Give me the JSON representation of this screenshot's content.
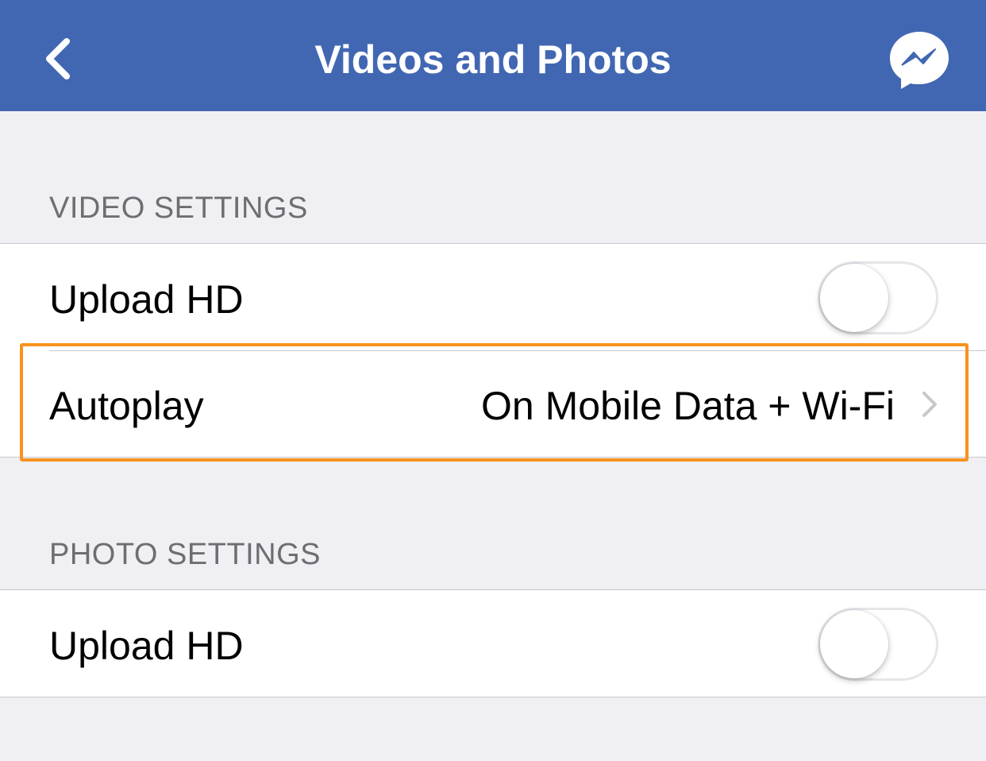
{
  "nav": {
    "title": "Videos and Photos",
    "back_icon": "chevron-left-icon",
    "messenger_icon": "messenger-icon",
    "bar_color": "#4267b2"
  },
  "video_settings": {
    "header": "VIDEO SETTINGS",
    "upload_hd": {
      "label": "Upload HD",
      "on": false
    },
    "autoplay": {
      "label": "Autoplay",
      "value": "On Mobile Data + Wi-Fi"
    }
  },
  "photo_settings": {
    "header": "PHOTO SETTINGS",
    "upload_hd": {
      "label": "Upload HD",
      "on": false
    }
  },
  "highlight_color": "#f7921e"
}
